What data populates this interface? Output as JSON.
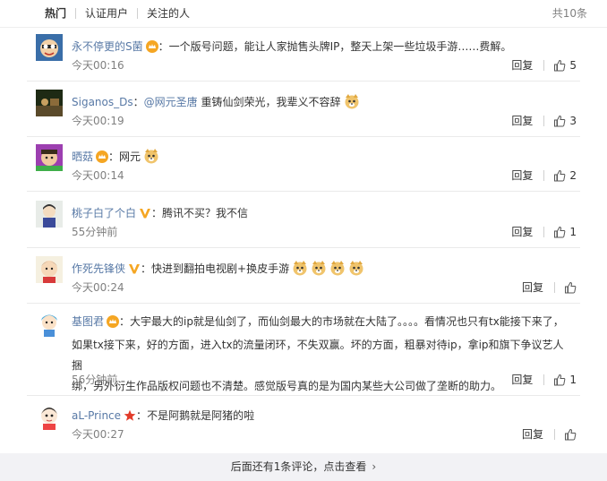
{
  "tabs": {
    "hot": "热门",
    "verified": "认证用户",
    "following": "关注的人",
    "total": "共10条"
  },
  "comments": [
    {
      "user": "永不停更的S菌",
      "text": "一个版号问题，能让人家抛售头牌IP，整天上架一些垃圾手游……费解。",
      "time": "今天00:16",
      "reply": "回复",
      "likes": "5",
      "badge": "crown"
    },
    {
      "user": "Siganos_Ds",
      "mention": "@网元圣唐",
      "text": "重铸仙剑荣光，我辈义不容辞",
      "time": "今天00:19",
      "reply": "回复",
      "likes": "3",
      "emojis": [
        "doge"
      ]
    },
    {
      "user": "晒菇",
      "text": "网元",
      "time": "今天00:14",
      "reply": "回复",
      "likes": "2",
      "badge": "crown",
      "emojis": [
        "doge"
      ]
    },
    {
      "user": "桃子白了个白",
      "text": "腾讯不买？我不信",
      "time": "55分钟前",
      "reply": "回复",
      "likes": "1",
      "badge": "vip"
    },
    {
      "user": "作死先锋侠",
      "text": "快进到翻拍电视剧+换皮手游",
      "time": "今天00:24",
      "reply": "回复",
      "likes": "",
      "badge": "vip",
      "emojis": [
        "doge",
        "doge",
        "doge",
        "doge"
      ]
    },
    {
      "user": "基图君",
      "text_lines": [
        "大宇最大的ip就是仙剑了，而仙剑最大的市场就在大陆了。。。。看情况也只有tx能接下来了，",
        "如果tx接下来，好的方面，进入tx的流量闭环，不失双赢。坏的方面，粗暴对待ip，拿ip和旗下争议艺人捆",
        "绑，另外衍生作品版权问题也不清楚。感觉版号真的是为国内某些大公司做了垄断的助力。"
      ],
      "time": "56分钟前",
      "reply": "回复",
      "likes": "1",
      "badge": "crown"
    },
    {
      "user": "aL-Prince",
      "text": "不是阿鹅就是阿猪的啦",
      "time": "今天00:27",
      "reply": "回复",
      "likes": "",
      "badge": "star"
    }
  ],
  "footer": {
    "label": "后面还有1条评论，点击查看"
  }
}
